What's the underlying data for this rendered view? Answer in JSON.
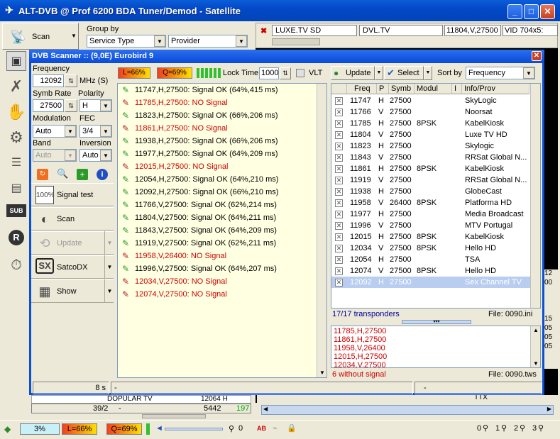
{
  "window": {
    "title": "ALT-DVB @ Prof 6200 BDA Tuner/Demod - Satellite"
  },
  "toolbar": {
    "scan_label": "Scan",
    "group_by_label": "Group by",
    "group_by_value": "Service Type",
    "provider_value": "Provider"
  },
  "channel_header": {
    "name": "LUXE.TV SD",
    "provider": "DVL.TV",
    "freq": "11804,V,27500",
    "video": "VID 704x5:"
  },
  "dialog": {
    "title": "DVB Scanner :: (9,0E) Eurobird 9",
    "frequency_label": "Frequency",
    "frequency_value": "12092",
    "frequency_unit": "MHz (S)",
    "symbrate_label": "Symb Rate",
    "symbrate_value": "27500",
    "polarity_label": "Polarity",
    "polarity_value": "H",
    "modulation_label": "Modulation",
    "modulation_value": "Auto",
    "fec_label": "FEC",
    "fec_value": "3/4",
    "band_label": "Band",
    "band_value": "Auto",
    "inversion_label": "Inversion",
    "inversion_value": "Auto",
    "level_label": "L=66%",
    "quality_label": "Q=69%",
    "lock_time_label": "Lock Time",
    "lock_time_value": "1000",
    "vlt_label": "VLT",
    "side_buttons": {
      "signal_test": "Signal test",
      "scan": "Scan",
      "update": "Update",
      "satcodx": "SatcoDX",
      "show": "Show"
    },
    "update_button": "Update",
    "select_button": "Select",
    "sort_by_label": "Sort by",
    "sort_by_value": "Frequency",
    "scan_log": [
      {
        "text": "11747,H,27500: Signal OK (64%,415 ms)",
        "ok": true
      },
      {
        "text": "11785,H,27500: NO Signal",
        "ok": false
      },
      {
        "text": "11823,H,27500: Signal OK (66%,206 ms)",
        "ok": true
      },
      {
        "text": "11861,H,27500: NO Signal",
        "ok": false
      },
      {
        "text": "11938,H,27500: Signal OK (66%,206 ms)",
        "ok": true
      },
      {
        "text": "11977,H,27500: Signal OK (64%,209 ms)",
        "ok": true
      },
      {
        "text": "12015,H,27500: NO Signal",
        "ok": false
      },
      {
        "text": "12054,H,27500: Signal OK (64%,210 ms)",
        "ok": true
      },
      {
        "text": "12092,H,27500: Signal OK (66%,210 ms)",
        "ok": true
      },
      {
        "text": "11766,V,27500: Signal OK (62%,214 ms)",
        "ok": true
      },
      {
        "text": "11804,V,27500: Signal OK (64%,211 ms)",
        "ok": true
      },
      {
        "text": "11843,V,27500: Signal OK (64%,209 ms)",
        "ok": true
      },
      {
        "text": "11919,V,27500: Signal OK (62%,211 ms)",
        "ok": true
      },
      {
        "text": "11958,V,26400: NO Signal",
        "ok": false
      },
      {
        "text": "11996,V,27500: Signal OK (64%,207 ms)",
        "ok": true
      },
      {
        "text": "12034,V,27500: NO Signal",
        "ok": false
      },
      {
        "text": "12074,V,27500: NO Signal",
        "ok": false
      }
    ],
    "columns": [
      "Freq",
      "P",
      "Symb",
      "Modul",
      "I",
      "Info/Prov"
    ],
    "transponders": [
      [
        "11747",
        "H",
        "27500",
        "",
        "",
        "SkyLogic"
      ],
      [
        "11766",
        "V",
        "27500",
        "",
        "",
        "Noorsat"
      ],
      [
        "11785",
        "H",
        "27500",
        "8PSK",
        "",
        "KabelKiosk"
      ],
      [
        "11804",
        "V",
        "27500",
        "",
        "",
        "Luxe TV HD"
      ],
      [
        "11823",
        "H",
        "27500",
        "",
        "",
        "Skylogic"
      ],
      [
        "11843",
        "V",
        "27500",
        "",
        "",
        "RRSat Global N..."
      ],
      [
        "11861",
        "H",
        "27500",
        "8PSK",
        "",
        "KabelKiosk"
      ],
      [
        "11919",
        "V",
        "27500",
        "",
        "",
        "RRSat Global N..."
      ],
      [
        "11938",
        "H",
        "27500",
        "",
        "",
        "GlobeCast"
      ],
      [
        "11958",
        "V",
        "26400",
        "8PSK",
        "",
        "Platforma HD"
      ],
      [
        "11977",
        "H",
        "27500",
        "",
        "",
        "Media Broadcast"
      ],
      [
        "11996",
        "V",
        "27500",
        "",
        "",
        "MTV Portugal"
      ],
      [
        "12015",
        "H",
        "27500",
        "8PSK",
        "",
        "KabelKiosk"
      ],
      [
        "12034",
        "V",
        "27500",
        "8PSK",
        "",
        "Hello HD"
      ],
      [
        "12054",
        "H",
        "27500",
        "",
        "",
        "TSA"
      ],
      [
        "12074",
        "V",
        "27500",
        "8PSK",
        "",
        "Hello HD"
      ],
      [
        "12092",
        "H",
        "27500",
        "",
        "",
        "Sex Channel TV"
      ]
    ],
    "transponder_count": "17/17 transponders",
    "file_ini": "File: 0090.ini",
    "no_signal_list": [
      "11785,H,27500",
      "11861,H,27500",
      "11958,V,26400",
      "12015,H,27500",
      "12034,V,27500"
    ],
    "no_signal_summary": "6 without signal",
    "file_tws": "File: 0090.tws",
    "status_time": "8 s",
    "status_dash1": "-",
    "status_dash2": "-"
  },
  "behind": {
    "list_row": "DOPULAR TV",
    "list_freq": "12064 H",
    "counter": "39/2",
    "dash": "-",
    "num1": "5442",
    "num2": "197",
    "tx": "TTX",
    "side_nums": [
      "15",
      "05",
      "05",
      "05"
    ],
    "side_nums2": [
      "12",
      "00"
    ]
  },
  "statusbar": {
    "percent": "3%",
    "level": "L=66%",
    "quality": "Q=69%",
    "zero": "0",
    "ab": "AB",
    "q0": "0",
    "q1": "1",
    "q2": "2",
    "q3": "3"
  }
}
